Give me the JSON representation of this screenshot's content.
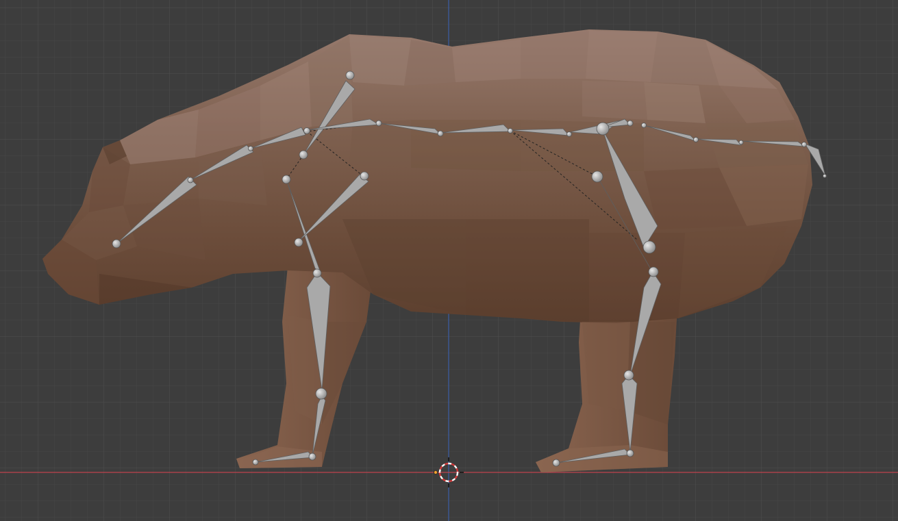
{
  "viewport": {
    "view": "orthographic-side",
    "background_color": "#3d3d3d",
    "grid_minor_color": "#474747",
    "grid_major_color": "#4d4d4d",
    "x_axis_color": "#c0424e",
    "z_axis_color": "#3b5fa8",
    "grid_visible": true
  },
  "mesh": {
    "name_icon": "bear-mesh",
    "shading": "solid",
    "base_color": "#7a5a47",
    "light_color": "#9c7b6a",
    "dark_color": "#5a3f2f"
  },
  "armature": {
    "name_icon": "armature-bones",
    "display": "octahedral",
    "bone_color": "#a3a3a3",
    "bone_shadow_color": "#7d7d7d",
    "relationship_line": "dashed"
  },
  "cursor": {
    "name_icon": "3d-cursor-icon",
    "color_a": "#ffffff",
    "color_b": "#d63a3a"
  }
}
